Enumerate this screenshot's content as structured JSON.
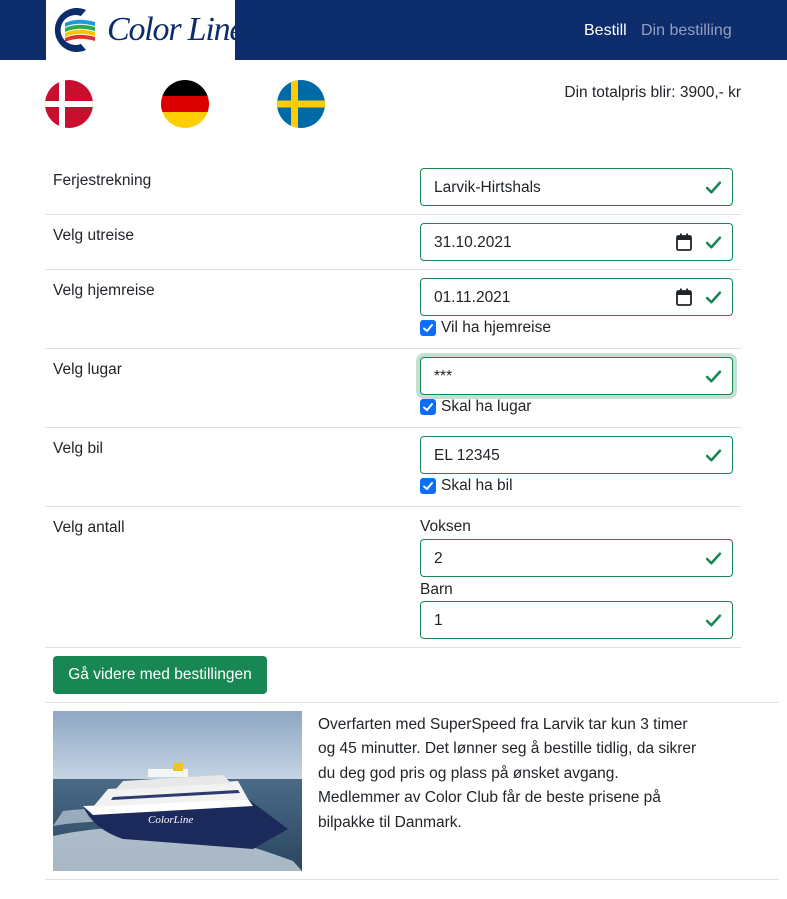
{
  "header": {
    "brand": "Color Line",
    "nav": {
      "bestill": "Bestill",
      "din_bestilling": "Din bestilling"
    }
  },
  "languages": [
    {
      "country": "Danmark",
      "icon": "danish-flag-icon"
    },
    {
      "country": "Tyskland",
      "icon": "german-flag-icon"
    },
    {
      "country": "Sverige",
      "icon": "swedish-flag-icon"
    }
  ],
  "total": {
    "text": "Din totalpris blir: 3900,- kr"
  },
  "form": {
    "ferjestrekning": {
      "label": "Ferjestrekning",
      "value": "Larvik-Hirtshals"
    },
    "utreise": {
      "label": "Velg utreise",
      "value": "31.10.2021"
    },
    "hjemreise": {
      "label": "Velg hjemreise",
      "value": "01.11.2021",
      "checkbox_label": "Vil ha hjemreise",
      "checked": true
    },
    "lugar": {
      "label": "Velg lugar",
      "value": "***",
      "checkbox_label": "Skal ha lugar",
      "checked": true
    },
    "bil": {
      "label": "Velg bil",
      "value": "EL 12345",
      "checkbox_label": "Skal ha bil",
      "checked": true
    },
    "antall": {
      "label": "Velg antall",
      "voksen_label": "Voksen",
      "voksen_value": "2",
      "barn_label": "Barn",
      "barn_value": "1"
    },
    "submit_label": "Gå videre med bestillingen"
  },
  "info": {
    "image_alt": "Color Line SuperSpeed ferry",
    "description": "Overfarten med SuperSpeed fra Larvik tar kun 3 timer og 45 minutter. Det lønner seg å bestille tidlig, da sikrer du deg god pris og plass på ønsket avgang. Medlemmer av Color Club får de beste prisene på bilpakke til Danmark."
  },
  "colors": {
    "navbar": "#0d2c6b",
    "valid": "#198754",
    "checkbox": "#0d6efd"
  }
}
